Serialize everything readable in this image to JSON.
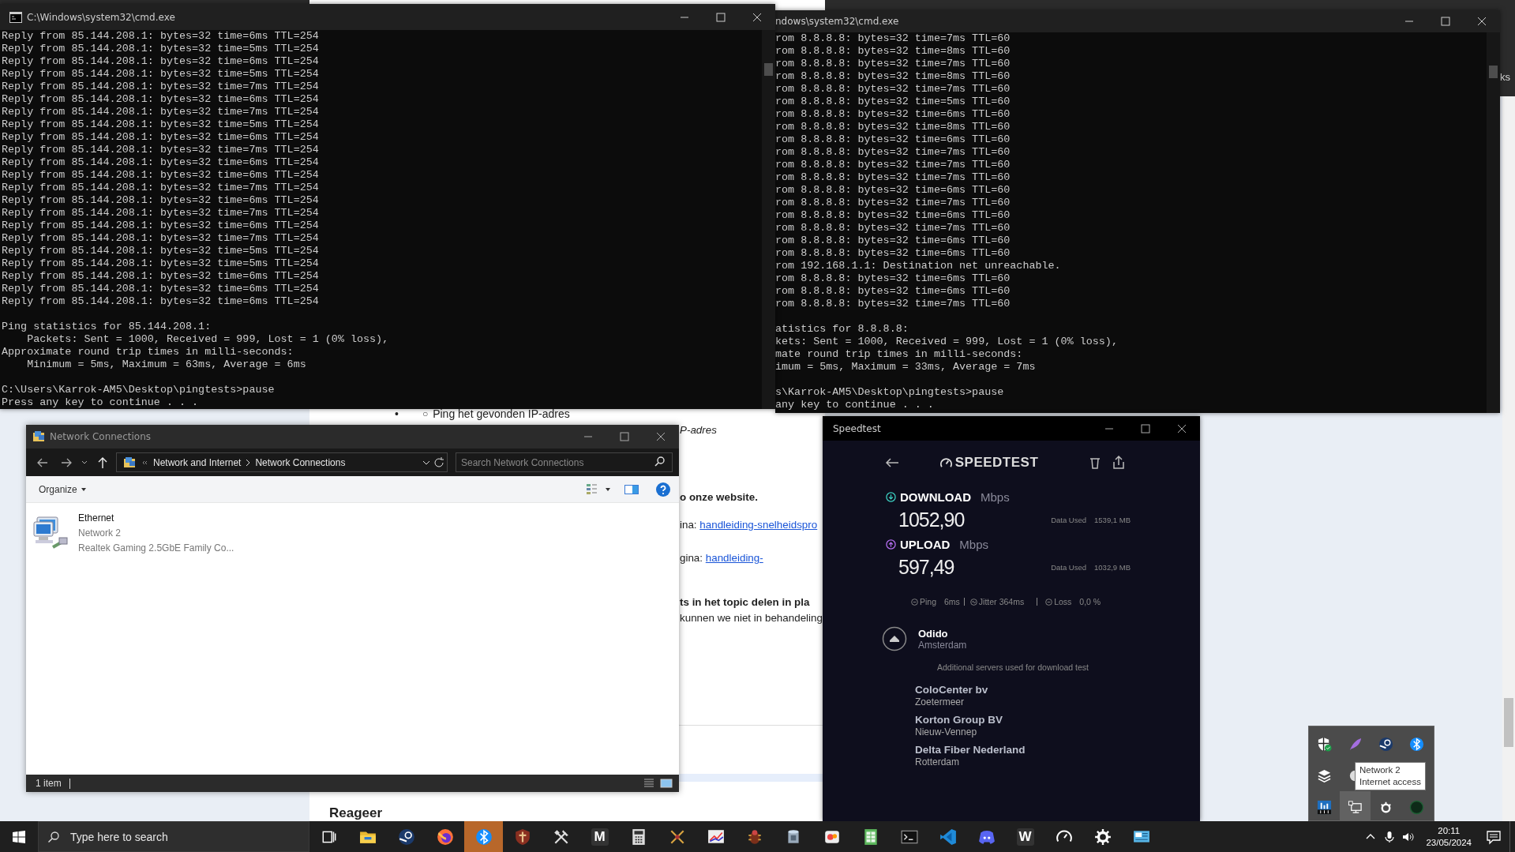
{
  "browser_header": {
    "fragment": "ks"
  },
  "cmd_windows": [
    {
      "title": "C:\\Windows\\system32\\cmd.exe",
      "blocks": [
        [
          "Reply from 85.144.208.1: bytes=32 time=6ms TTL=254",
          "Reply from 85.144.208.1: bytes=32 time=5ms TTL=254",
          "Reply from 85.144.208.1: bytes=32 time=6ms TTL=254",
          "Reply from 85.144.208.1: bytes=32 time=5ms TTL=254",
          "Reply from 85.144.208.1: bytes=32 time=7ms TTL=254",
          "Reply from 85.144.208.1: bytes=32 time=6ms TTL=254",
          "Reply from 85.144.208.1: bytes=32 time=7ms TTL=254",
          "Reply from 85.144.208.1: bytes=32 time=5ms TTL=254",
          "Reply from 85.144.208.1: bytes=32 time=6ms TTL=254",
          "Reply from 85.144.208.1: bytes=32 time=7ms TTL=254",
          "Reply from 85.144.208.1: bytes=32 time=6ms TTL=254",
          "Reply from 85.144.208.1: bytes=32 time=6ms TTL=254",
          "Reply from 85.144.208.1: bytes=32 time=7ms TTL=254",
          "Reply from 85.144.208.1: bytes=32 time=6ms TTL=254",
          "Reply from 85.144.208.1: bytes=32 time=7ms TTL=254",
          "Reply from 85.144.208.1: bytes=32 time=6ms TTL=254",
          "Reply from 85.144.208.1: bytes=32 time=7ms TTL=254",
          "Reply from 85.144.208.1: bytes=32 time=5ms TTL=254",
          "Reply from 85.144.208.1: bytes=32 time=5ms TTL=254",
          "Reply from 85.144.208.1: bytes=32 time=6ms TTL=254",
          "Reply from 85.144.208.1: bytes=32 time=6ms TTL=254",
          "Reply from 85.144.208.1: bytes=32 time=6ms TTL=254"
        ],
        [
          "Ping statistics for 85.144.208.1:",
          "    Packets: Sent = 1000, Received = 999, Lost = 1 (0% loss),",
          "Approximate round trip times in milli-seconds:",
          "    Minimum = 5ms, Maximum = 63ms, Average = 6ms"
        ],
        [
          "C:\\Users\\Karrok-AM5\\Desktop\\pingtests>pause",
          "Press any key to continue . . ."
        ]
      ]
    },
    {
      "title": "ndows\\system32\\cmd.exe",
      "blocks": [
        [
          "rom 8.8.8.8: bytes=32 time=7ms TTL=60",
          "rom 8.8.8.8: bytes=32 time=8ms TTL=60",
          "rom 8.8.8.8: bytes=32 time=7ms TTL=60",
          "rom 8.8.8.8: bytes=32 time=8ms TTL=60",
          "rom 8.8.8.8: bytes=32 time=7ms TTL=60",
          "rom 8.8.8.8: bytes=32 time=5ms TTL=60",
          "rom 8.8.8.8: bytes=32 time=6ms TTL=60",
          "rom 8.8.8.8: bytes=32 time=8ms TTL=60",
          "rom 8.8.8.8: bytes=32 time=6ms TTL=60",
          "rom 8.8.8.8: bytes=32 time=7ms TTL=60",
          "rom 8.8.8.8: bytes=32 time=7ms TTL=60",
          "rom 8.8.8.8: bytes=32 time=7ms TTL=60",
          "rom 8.8.8.8: bytes=32 time=6ms TTL=60",
          "rom 8.8.8.8: bytes=32 time=7ms TTL=60",
          "rom 8.8.8.8: bytes=32 time=6ms TTL=60",
          "rom 8.8.8.8: bytes=32 time=7ms TTL=60",
          "rom 8.8.8.8: bytes=32 time=6ms TTL=60",
          "rom 8.8.8.8: bytes=32 time=6ms TTL=60",
          "rom 192.168.1.1: Destination net unreachable.",
          "rom 8.8.8.8: bytes=32 time=6ms TTL=60",
          "rom 8.8.8.8: bytes=32 time=6ms TTL=60",
          "rom 8.8.8.8: bytes=32 time=7ms TTL=60"
        ],
        [
          "atistics for 8.8.8.8:",
          "kets: Sent = 1000, Received = 999, Lost = 1 (0% loss),",
          "mate round trip times in milli-seconds:",
          "imum = 5ms, Maximum = 33ms, Average = 7ms"
        ],
        [
          "s\\Karrok-AM5\\Desktop\\pingtests>pause",
          "any key to continue . . ."
        ]
      ]
    }
  ],
  "web_page": {
    "bullet": {
      "marker": "•",
      "sub_marker": "○",
      "text": "Ping het gevonden IP-adres"
    },
    "fragments": [
      {
        "kind": "italic",
        "text": "P-adres"
      },
      {
        "kind": "bold",
        "text": "o onze website."
      },
      {
        "kind": "link",
        "prefix": "ina: ",
        "link": "handleiding-snelheidspro"
      },
      {
        "kind": "link",
        "prefix": "gina: ",
        "link": "handleiding-"
      },
      {
        "kind": "bold",
        "text": "ts in het topic delen in pla"
      },
      {
        "kind": "plain",
        "text": "kunnen we niet in behandeling"
      }
    ],
    "heading": "Reageer"
  },
  "network_window": {
    "title": "Network Connections",
    "breadcrumb": [
      "Network and Internet",
      "Network Connections"
    ],
    "search": {
      "placeholder": "Search Network Connections"
    },
    "organize": "Organize",
    "items": [
      {
        "name": "Ethernet",
        "network": "Network 2",
        "adapter": "Realtek Gaming 2.5GbE Family Co..."
      }
    ],
    "status": "1 item"
  },
  "speedtest": {
    "title": "Speedtest",
    "logo": "SPEEDTEST",
    "results": [
      {
        "kind": "download",
        "label": "DOWNLOAD",
        "unit": "Mbps",
        "value": "1052,90",
        "data_label": "Data Used",
        "data_value": "1539,1 MB"
      },
      {
        "kind": "upload",
        "label": "UPLOAD",
        "unit": "Mbps",
        "value": "597,49",
        "data_label": "Data Used",
        "data_value": "1032,9 MB"
      }
    ],
    "ping": {
      "label": "Ping",
      "value": "6ms"
    },
    "jitter": {
      "label": "Jitter",
      "value": "364ms"
    },
    "loss": {
      "label": "Loss",
      "value": "0,0 %"
    },
    "server": {
      "name": "Odido",
      "city": "Amsterdam"
    },
    "additional_note": "Additional servers used for download test",
    "additional_servers": [
      {
        "name": "ColoCenter bv",
        "city": "Zoetermeer"
      },
      {
        "name": "Korton Group BV",
        "city": "Nieuw-Vennep"
      },
      {
        "name": "Delta Fiber Nederland",
        "city": "Rotterdam"
      }
    ]
  },
  "tray_popup": {
    "rows": [
      [
        {
          "kind": "shield",
          "highlighted": false
        },
        {
          "kind": "feather",
          "highlighted": false
        },
        {
          "kind": "disc",
          "highlighted": false
        },
        {
          "kind": "swirl",
          "highlighted": false
        }
      ],
      [
        {
          "kind": "layers",
          "highlighted": false
        },
        {
          "kind": "round",
          "highlighted": false
        }
      ],
      [
        {
          "kind": "bars",
          "highlighted": false
        },
        {
          "kind": "network",
          "highlighted": true
        },
        {
          "kind": "cog",
          "highlighted": false
        },
        {
          "kind": "ring",
          "highlighted": false
        }
      ]
    ],
    "tooltip": {
      "title": "Network 2",
      "status": "Internet access"
    }
  },
  "taskbar": {
    "search": {
      "placeholder": "Type here to search"
    },
    "apps": [
      {
        "kind": "task-view",
        "selected": false
      },
      {
        "kind": "folder",
        "selected": false
      },
      {
        "kind": "disc",
        "selected": false
      },
      {
        "kind": "fox",
        "selected": false
      },
      {
        "kind": "swirl",
        "selected": true
      },
      {
        "kind": "shield",
        "selected": false
      },
      {
        "kind": "tools",
        "selected": false
      },
      {
        "kind": "letter",
        "letter": "M",
        "selected": false
      },
      {
        "kind": "calculator",
        "selected": false
      },
      {
        "kind": "swords",
        "selected": false
      },
      {
        "kind": "chart",
        "selected": false
      },
      {
        "kind": "beetle",
        "selected": false
      },
      {
        "kind": "cylinder",
        "selected": false
      },
      {
        "kind": "game",
        "selected": false
      },
      {
        "kind": "sheet",
        "selected": false
      },
      {
        "kind": "terminal",
        "selected": false
      },
      {
        "kind": "code",
        "selected": false
      },
      {
        "kind": "chat",
        "selected": false
      },
      {
        "kind": "letter",
        "letter": "W",
        "selected": false
      },
      {
        "kind": "gauge",
        "selected": false
      },
      {
        "kind": "gear",
        "selected": false
      },
      {
        "kind": "screen",
        "selected": false
      }
    ],
    "clock": {
      "time": "20:11",
      "date": "23/05/2024"
    }
  }
}
